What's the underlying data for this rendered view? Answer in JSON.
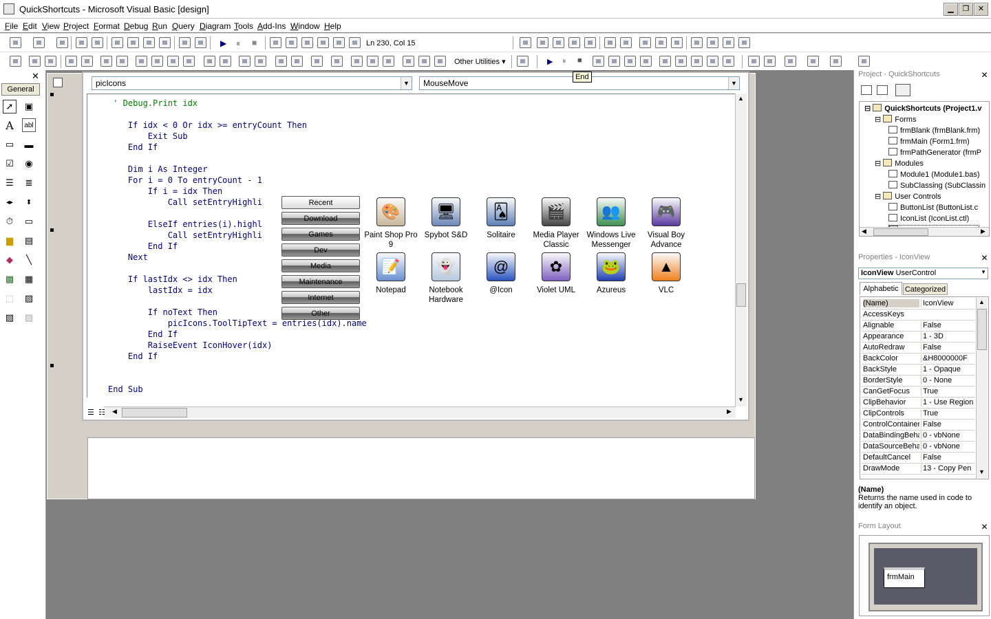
{
  "window": {
    "title": "QuickShortcuts - Microsoft Visual Basic [design]"
  },
  "menu": [
    "File",
    "Edit",
    "View",
    "Project",
    "Format",
    "Debug",
    "Run",
    "Query",
    "Diagram",
    "Tools",
    "Add-Ins",
    "Window",
    "Help"
  ],
  "toolbar": {
    "position_readout": "Ln 230, Col 15",
    "other_utilities_label": "Other Utilities",
    "tooltip": "End"
  },
  "toolbox": {
    "title": "General"
  },
  "code_window": {
    "object_combo": "picIcons",
    "procedure_combo": "MouseMove",
    "lines": [
      {
        "text": " ' Debug.Print idx",
        "kind": "comment"
      },
      {
        "text": "",
        "kind": "code"
      },
      {
        "text": "    If idx < 0 Or idx >= entryCount Then",
        "kind": "code"
      },
      {
        "text": "        Exit Sub",
        "kind": "code"
      },
      {
        "text": "    End If",
        "kind": "code"
      },
      {
        "text": "",
        "kind": "code"
      },
      {
        "text": "    Dim i As Integer",
        "kind": "code"
      },
      {
        "text": "    For i = 0 To entryCount - 1",
        "kind": "code"
      },
      {
        "text": "        If i = idx Then",
        "kind": "code"
      },
      {
        "text": "            Call setEntryHighli",
        "kind": "code"
      },
      {
        "text": "",
        "kind": "code"
      },
      {
        "text": "        ElseIf entries(i).highl",
        "kind": "code"
      },
      {
        "text": "            Call setEntryHighli",
        "kind": "code"
      },
      {
        "text": "        End If",
        "kind": "code"
      },
      {
        "text": "    Next",
        "kind": "code"
      },
      {
        "text": "",
        "kind": "code"
      },
      {
        "text": "    If lastIdx <> idx Then",
        "kind": "code"
      },
      {
        "text": "        lastIdx = idx",
        "kind": "code"
      },
      {
        "text": "",
        "kind": "code"
      },
      {
        "text": "        If noText Then",
        "kind": "code"
      },
      {
        "text": "            picIcons.ToolTipText = entries(idx).name",
        "kind": "code"
      },
      {
        "text": "        End If",
        "kind": "code"
      },
      {
        "text": "        RaiseEvent IconHover(idx)",
        "kind": "code"
      },
      {
        "text": "    End If",
        "kind": "code"
      },
      {
        "text": "",
        "kind": "code"
      },
      {
        "text": "",
        "kind": "code"
      },
      {
        "text": "End Sub",
        "kind": "code"
      }
    ]
  },
  "iconview": {
    "categories": [
      "Recent",
      "Download",
      "Games",
      "Dev",
      "Media",
      "Maintenance",
      "Internet",
      "Other"
    ],
    "apps": [
      {
        "label": "Paint Shop Pro\n9",
        "glyph": "🎨"
      },
      {
        "label": "Spybot S&D",
        "glyph": "🖥"
      },
      {
        "label": "Solitaire",
        "glyph": "🂡"
      },
      {
        "label": "Media Player\nClassic",
        "glyph": "🎬"
      },
      {
        "label": "Windows Live\nMessenger",
        "glyph": "👥"
      },
      {
        "label": "Visual Boy\nAdvance",
        "glyph": "🎮"
      },
      {
        "label": "Notepad",
        "glyph": "📝"
      },
      {
        "label": "Notebook\nHardware",
        "glyph": "👻"
      },
      {
        "label": "@Icon",
        "glyph": "@"
      },
      {
        "label": "Violet UML",
        "glyph": "✿"
      },
      {
        "label": "Azureus",
        "glyph": "🐸"
      },
      {
        "label": "VLC",
        "glyph": "▲"
      }
    ]
  },
  "project": {
    "title": "Project - QuickShortcuts",
    "root": "QuickShortcuts (Project1.v",
    "tree": [
      {
        "label": "Forms",
        "level": 1
      },
      {
        "label": "frmBlank (frmBlank.frm)",
        "level": 2
      },
      {
        "label": "frmMain (Form1.frm)",
        "level": 2
      },
      {
        "label": "frmPathGenerator (frmP",
        "level": 2
      },
      {
        "label": "Modules",
        "level": 1
      },
      {
        "label": "Module1 (Module1.bas)",
        "level": 2
      },
      {
        "label": "SubClassing (SubClassin",
        "level": 2
      },
      {
        "label": "User Controls",
        "level": 1
      },
      {
        "label": "ButtonList (ButtonList.c",
        "level": 2
      },
      {
        "label": "IconList (IconList.ctl)",
        "level": 2
      },
      {
        "label": "IconView (IconView.ctl)",
        "level": 2
      }
    ]
  },
  "properties": {
    "title": "Properties - IconView",
    "object": "IconView",
    "object_type": "UserControl",
    "tabs": [
      "Alphabetic",
      "Categorized"
    ],
    "rows": [
      [
        "(Name)",
        "IconView"
      ],
      [
        "AccessKeys",
        ""
      ],
      [
        "Alignable",
        "False"
      ],
      [
        "Appearance",
        "1 - 3D"
      ],
      [
        "AutoRedraw",
        "False"
      ],
      [
        "BackColor",
        "&H8000000F"
      ],
      [
        "BackStyle",
        "1 - Opaque"
      ],
      [
        "BorderStyle",
        "0 - None"
      ],
      [
        "CanGetFocus",
        "True"
      ],
      [
        "ClipBehavior",
        "1 - Use Region"
      ],
      [
        "ClipControls",
        "True"
      ],
      [
        "ControlContainer",
        "False"
      ],
      [
        "DataBindingBehav",
        "0 - vbNone"
      ],
      [
        "DataSourceBehav",
        "0 - vbNone"
      ],
      [
        "DefaultCancel",
        "False"
      ],
      [
        "DrawMode",
        "13 - Copy Pen"
      ]
    ],
    "desc_title": "(Name)",
    "desc_text": "Returns the name used in code to identify an object."
  },
  "form_layout": {
    "title": "Form Layout",
    "form_label": "frmMain"
  },
  "colors": {
    "keyword": "#00007f",
    "comment": "#008000",
    "text": "#000000"
  }
}
